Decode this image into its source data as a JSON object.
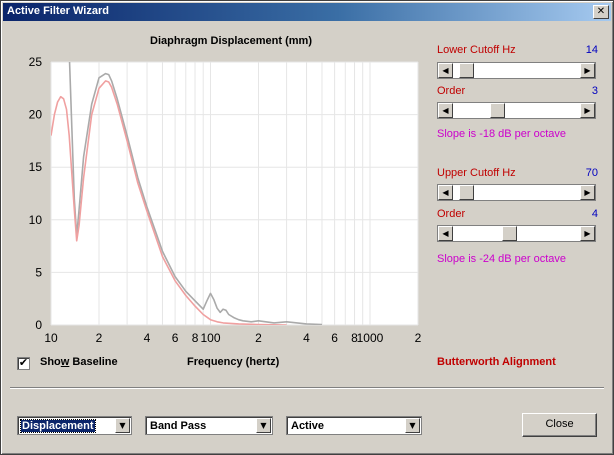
{
  "window": {
    "title": "Active Filter Wizard",
    "close_glyph": "✕"
  },
  "chart": {
    "title": "Diaphragm Displacement (mm)",
    "x_label": "Frequency (hertz)"
  },
  "chart_data": {
    "type": "line",
    "title": "Diaphragm Displacement (mm)",
    "xlabel": "Frequency (hertz)",
    "ylabel": "",
    "x_scale": "log",
    "xlim": [
      10,
      2000
    ],
    "ylim": [
      0,
      25
    ],
    "grid": true,
    "y_ticks": [
      "0",
      "5",
      "10",
      "15",
      "20",
      "25"
    ],
    "x_ticks": [
      "10",
      "2",
      "4",
      "6",
      "8",
      "100",
      "2",
      "4",
      "6",
      "8",
      "1000",
      "2"
    ],
    "series": [
      {
        "color": "#aaaaaa",
        "x": [
          10,
          11,
          12,
          13,
          14,
          14.5,
          15,
          16,
          18,
          20,
          22,
          23,
          24,
          26,
          30,
          35,
          40,
          50,
          60,
          70,
          80,
          90,
          95,
          100,
          105,
          110,
          115,
          120,
          125,
          130,
          140,
          150,
          160,
          180,
          200,
          250,
          300,
          400,
          500
        ],
        "y": [
          26,
          40,
          60,
          26,
          12,
          8.5,
          11,
          16,
          21,
          23.5,
          23.9,
          23.8,
          23.2,
          21.5,
          18,
          14,
          11.2,
          7,
          4.6,
          3.2,
          2.3,
          1.5,
          2.3,
          3.0,
          2.4,
          1.6,
          1.2,
          1.5,
          1.4,
          1.0,
          0.7,
          0.5,
          0.4,
          0.3,
          0.4,
          0.2,
          0.3,
          0.1,
          0.05
        ]
      },
      {
        "color": "#f0a0a0",
        "x": [
          10,
          10.5,
          11,
          11.5,
          12,
          12.5,
          13,
          14,
          14.5,
          15,
          16,
          18,
          20,
          22,
          23,
          24,
          26,
          30,
          35,
          40,
          50,
          60,
          70,
          80,
          90,
          100,
          110,
          120,
          150,
          200,
          300
        ],
        "y": [
          18,
          20,
          21.2,
          21.7,
          21.5,
          20.5,
          18,
          11,
          8,
          9.5,
          14,
          20,
          22.5,
          23.2,
          23.1,
          22.6,
          21,
          17.5,
          13.5,
          10.8,
          6.5,
          4.2,
          2.8,
          1.8,
          1.0,
          0.5,
          0.3,
          0.2,
          0.1,
          0.05,
          0
        ]
      }
    ]
  },
  "lower": {
    "label": "Lower Cutoff  Hz",
    "value": "14",
    "order_label": "Order",
    "order_value": "3",
    "slope": "Slope is -18 dB per octave",
    "freq_position": 0.05,
    "order_position": 0.33
  },
  "upper": {
    "label": "Upper Cutoff  Hz",
    "value": "70",
    "order_label": "Order",
    "order_value": "4",
    "slope": "Slope is -24 dB per octave",
    "freq_position": 0.05,
    "order_position": 0.44
  },
  "baseline": {
    "label": "Show Baseline",
    "checked": true,
    "check_glyph": "✔"
  },
  "alignment": "Butterworth Alignment",
  "combos": {
    "mode": "Displacement",
    "filter": "Band Pass",
    "type": "Active",
    "arrow": "▼"
  },
  "scroll_arrows": {
    "left": "◀",
    "right": "▶"
  },
  "close_button": "Close",
  "colors": {
    "title_bar": "#0a246a",
    "label_red": "#c00000",
    "value_blue": "#0000c0",
    "slope_magenta": "#cc00cc",
    "baseline_curve": "#aaaaaa",
    "filtered_curve": "#f0a0a0"
  }
}
